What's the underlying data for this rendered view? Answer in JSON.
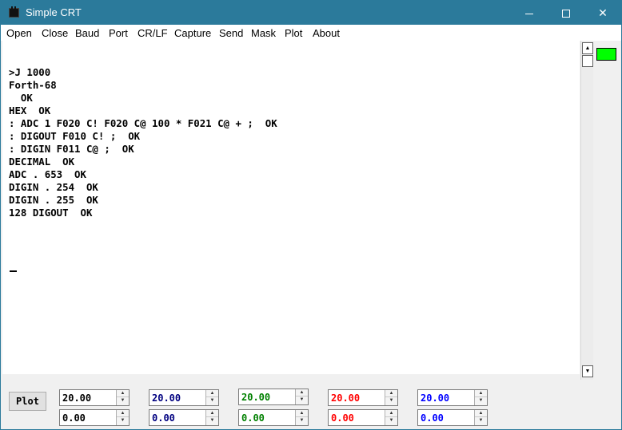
{
  "window": {
    "title": "Simple CRT"
  },
  "menu": [
    "Open",
    "Close",
    "Baud",
    "Port",
    "CR/LF",
    "Capture",
    "Send",
    "Mask",
    "Plot",
    "About"
  ],
  "terminal": {
    "lines": [
      ">J 1000",
      "Forth-68",
      "  OK",
      "HEX  OK",
      ": ADC 1 F020 C! F020 C@ 100 * F021 C@ + ;  OK",
      ": DIGOUT F010 C! ;  OK",
      ": DIGIN F011 C@ ;  OK",
      "DECIMAL  OK",
      "ADC . 653  OK",
      "DIGIN . 254  OK",
      "DIGIN . 255  OK",
      "128 DIGOUT  OK"
    ]
  },
  "indicator": {
    "color": "#00ff00"
  },
  "plot_button": {
    "label": "Plot"
  },
  "channels": [
    {
      "scale": "20.00",
      "offset": "0.00",
      "scale_color": "#000000",
      "offset_color": "#000000"
    },
    {
      "scale": "20.00",
      "offset": "0.00",
      "scale_color": "#000080",
      "offset_color": "#000080"
    },
    {
      "scale": "20.00",
      "offset": "0.00",
      "scale_color": "#008000",
      "offset_color": "#008000"
    },
    {
      "scale": "20.00",
      "offset": "0.00",
      "scale_color": "#ff0000",
      "offset_color": "#ff0000"
    },
    {
      "scale": "20.00",
      "offset": "0.00",
      "scale_color": "#0000ff",
      "offset_color": "#0000ff"
    }
  ]
}
